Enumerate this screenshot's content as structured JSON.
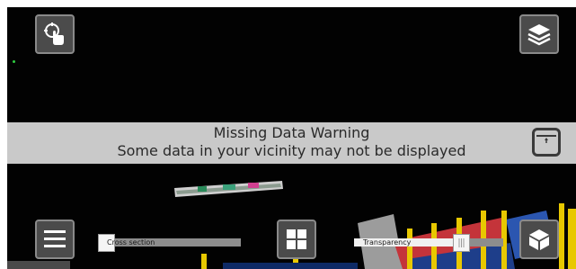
{
  "viewer": {
    "buttons": {
      "locate_icon": "tap-target-icon",
      "layers_icon": "layers-icon",
      "menu_icon": "hamburger-menu-icon",
      "grid_icon": "grid-icon",
      "cube_icon": "3d-cube-icon"
    },
    "banner": {
      "title": "Missing Data Warning",
      "message": "Some data in your vicinity may not be displayed",
      "action_icon": "expand-icon"
    },
    "cross_section": {
      "label": "Cross section",
      "value": 0.0
    },
    "transparency": {
      "label": "Transparency",
      "value": 0.7
    },
    "colors": {
      "scene_bg": "#020202",
      "banner_bg": "#c9c9c9",
      "button_bg": "#4b4b4b"
    }
  }
}
